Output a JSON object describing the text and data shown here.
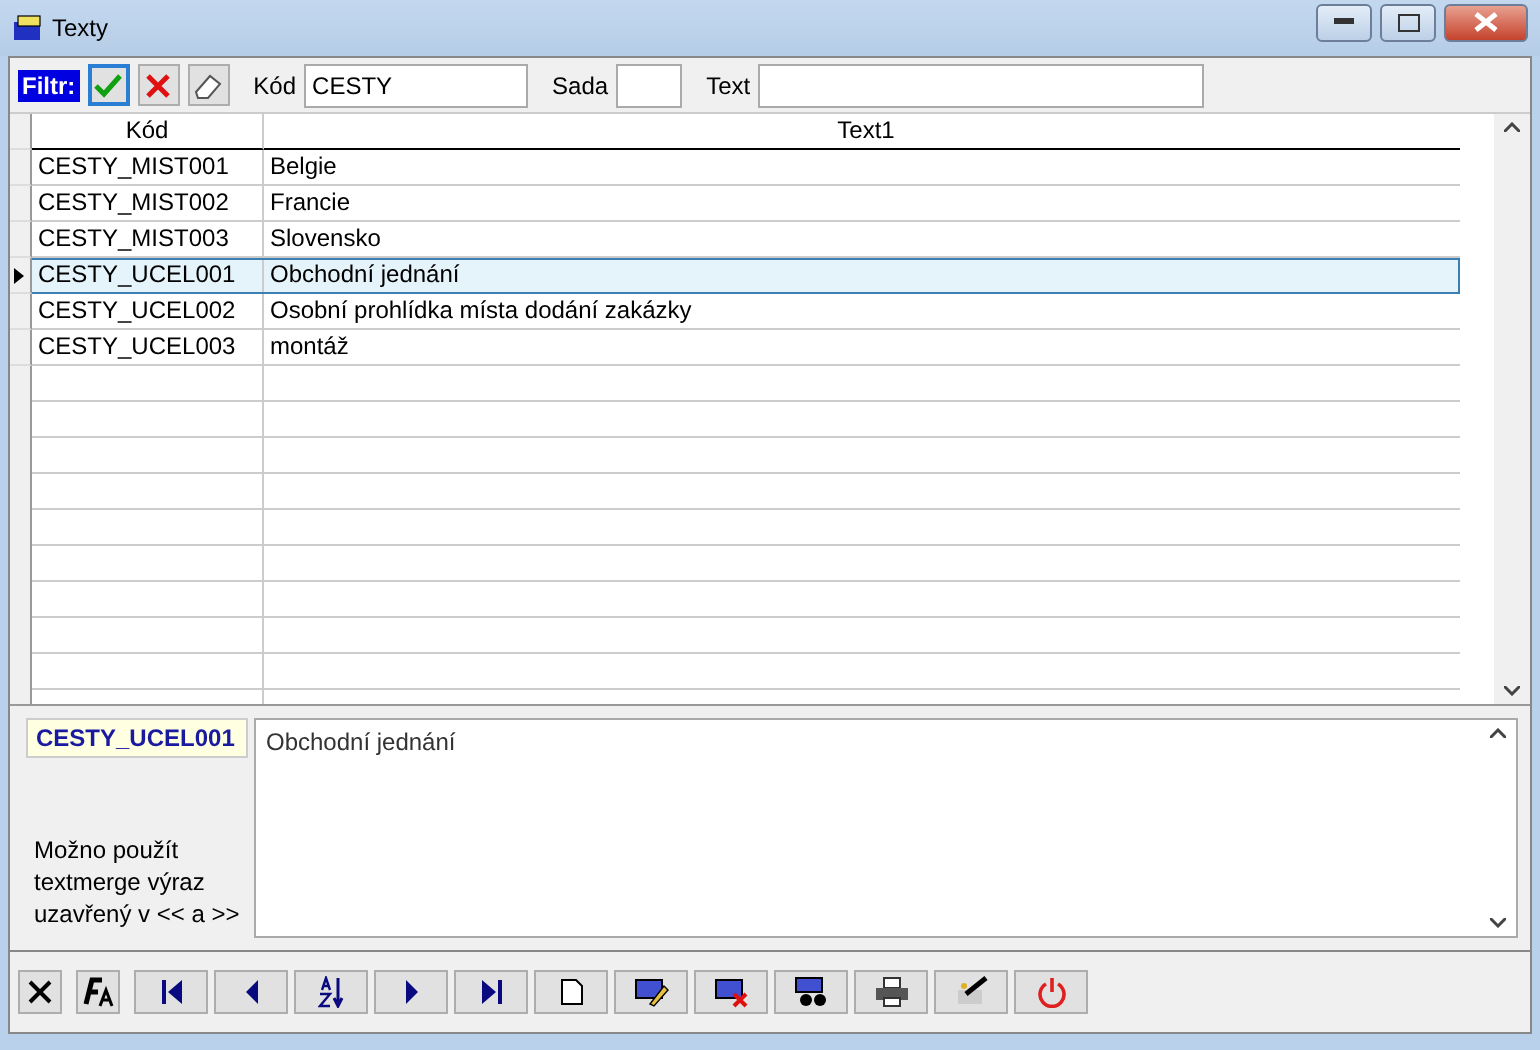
{
  "window": {
    "title": "Texty"
  },
  "filter": {
    "label": "Filtr:",
    "fields": [
      {
        "label": "Kód",
        "value": "CESTY"
      },
      {
        "label": "Sada"
      },
      {
        "label": "Text"
      }
    ]
  },
  "table": {
    "columns": [
      "Kód",
      "Text1"
    ],
    "rows": [
      {
        "code": "CESTY_MIST001",
        "text": "Belgie",
        "selected": false
      },
      {
        "code": "CESTY_MIST002",
        "text": "Francie",
        "selected": false
      },
      {
        "code": "CESTY_MIST003",
        "text": "Slovensko",
        "selected": false
      },
      {
        "code": "CESTY_UCEL001",
        "text": "Obchodní jednání",
        "selected": true
      },
      {
        "code": "CESTY_UCEL002",
        "text": "Osobní prohlídka místa dodání zakázky",
        "selected": false
      },
      {
        "code": "CESTY_UCEL003",
        "text": "montáž",
        "selected": false
      }
    ]
  },
  "detail": {
    "code": "CESTY_UCEL001",
    "text": "Obchodní jednání",
    "hint": "Možno použít textmerge výraz uzavřený v << a >>"
  },
  "toolbar": [
    {
      "kind": "close"
    },
    {
      "kind": "font"
    },
    {
      "kind": "first"
    },
    {
      "kind": "prev"
    },
    {
      "kind": "sort"
    },
    {
      "kind": "next"
    },
    {
      "kind": "last"
    },
    {
      "kind": "new"
    },
    {
      "kind": "edit"
    },
    {
      "kind": "delete"
    },
    {
      "kind": "find"
    },
    {
      "kind": "print"
    },
    {
      "kind": "wand"
    },
    {
      "kind": "power"
    }
  ]
}
